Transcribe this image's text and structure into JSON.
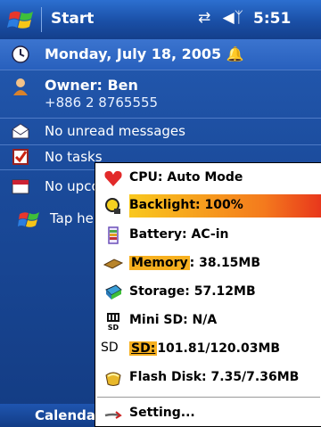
{
  "titlebar": {
    "app_title": "Start",
    "status_icons": "⇄ₓ ◀‹",
    "time": "5:51"
  },
  "today": {
    "date": "Monday, July 18, 2005",
    "owner_name": "Owner: Ben",
    "owner_phone": "+886 2 8765555",
    "messages": "No unread messages",
    "tasks": "No tasks",
    "appointments": "No upco",
    "tip": "Tap her"
  },
  "softkeys": {
    "left": "Calendar"
  },
  "menu": {
    "items": [
      {
        "icon": "heart-icon",
        "prefix": "",
        "highlight": "",
        "suffix": "CPU: Auto Mode"
      },
      {
        "icon": "lightbulb-icon",
        "prefix": "",
        "highlight": "Backlight: 100%",
        "suffix": ""
      },
      {
        "icon": "battery-icon",
        "prefix": "",
        "highlight": "",
        "suffix": "Battery: AC-in"
      },
      {
        "icon": "memory-chip-icon",
        "prefix": "",
        "highlight": "Memory",
        "suffix": ": 38.15MB"
      },
      {
        "icon": "storage-icon",
        "prefix": "",
        "highlight": "",
        "suffix": "Storage: 57.12MB"
      },
      {
        "icon": "mini-sd-icon",
        "icon_label": "Mini SD",
        "prefix": "",
        "highlight": "",
        "suffix": "Mini SD: N/A"
      },
      {
        "icon": "sd-card-icon",
        "icon_label": "SD",
        "prefix": "",
        "highlight": "SD:",
        "suffix": "101.81/120.03MB"
      },
      {
        "icon": "flash-disk-icon",
        "prefix": "",
        "highlight": "",
        "suffix": "Flash Disk: 7.35/7.36MB"
      },
      {
        "icon": "arrow-right-icon",
        "prefix": "",
        "highlight": "",
        "suffix": "Setting..."
      }
    ]
  },
  "colors": {
    "title_bar": "#1a4fa6",
    "today_bg": "#1a4a9a",
    "highlight_orange": "#f7b01f",
    "highlight_red": "#e8361c"
  }
}
